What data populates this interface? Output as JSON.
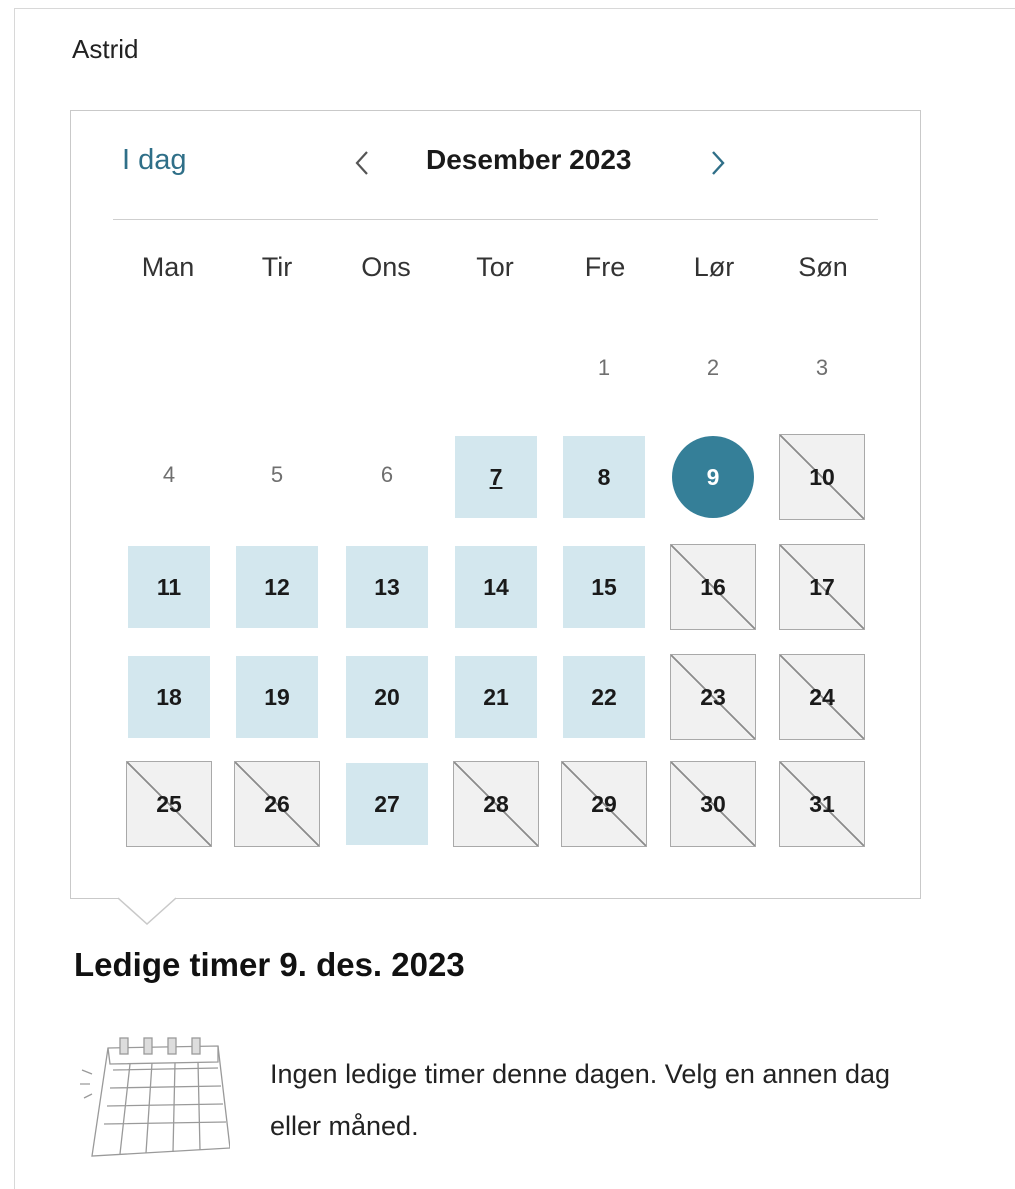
{
  "person": {
    "name": "Astrid"
  },
  "calendar": {
    "today_label": "I dag",
    "month_label": "Desember 2023",
    "weekdays": [
      "Man",
      "Tir",
      "Ons",
      "Tor",
      "Fre",
      "Lør",
      "Søn"
    ],
    "days": [
      {
        "n": "1",
        "state": "past"
      },
      {
        "n": "2",
        "state": "past"
      },
      {
        "n": "3",
        "state": "past"
      },
      {
        "n": "4",
        "state": "past"
      },
      {
        "n": "5",
        "state": "past"
      },
      {
        "n": "6",
        "state": "past"
      },
      {
        "n": "7",
        "state": "available",
        "today": true
      },
      {
        "n": "8",
        "state": "available"
      },
      {
        "n": "9",
        "state": "selected"
      },
      {
        "n": "10",
        "state": "unavailable"
      },
      {
        "n": "11",
        "state": "available"
      },
      {
        "n": "12",
        "state": "available"
      },
      {
        "n": "13",
        "state": "available"
      },
      {
        "n": "14",
        "state": "available"
      },
      {
        "n": "15",
        "state": "available"
      },
      {
        "n": "16",
        "state": "unavailable"
      },
      {
        "n": "17",
        "state": "unavailable"
      },
      {
        "n": "18",
        "state": "available"
      },
      {
        "n": "19",
        "state": "available"
      },
      {
        "n": "20",
        "state": "available"
      },
      {
        "n": "21",
        "state": "available"
      },
      {
        "n": "22",
        "state": "available"
      },
      {
        "n": "23",
        "state": "unavailable"
      },
      {
        "n": "24",
        "state": "unavailable"
      },
      {
        "n": "25",
        "state": "unavailable"
      },
      {
        "n": "26",
        "state": "unavailable"
      },
      {
        "n": "27",
        "state": "available"
      },
      {
        "n": "28",
        "state": "unavailable"
      },
      {
        "n": "29",
        "state": "unavailable"
      },
      {
        "n": "30",
        "state": "unavailable"
      },
      {
        "n": "31",
        "state": "unavailable"
      }
    ],
    "first_weekday_index": 4
  },
  "slots": {
    "title": "Ledige timer 9. des. 2023",
    "empty_message": "Ingen ledige timer denne dagen. Velg en annen dag eller måned.",
    "empty_icon": "calendar-icon"
  },
  "colors": {
    "accent": "#357f98",
    "available_bg": "#d3e7ee",
    "unavailable_bg": "#f1f1f1",
    "link": "#2f6f88"
  }
}
